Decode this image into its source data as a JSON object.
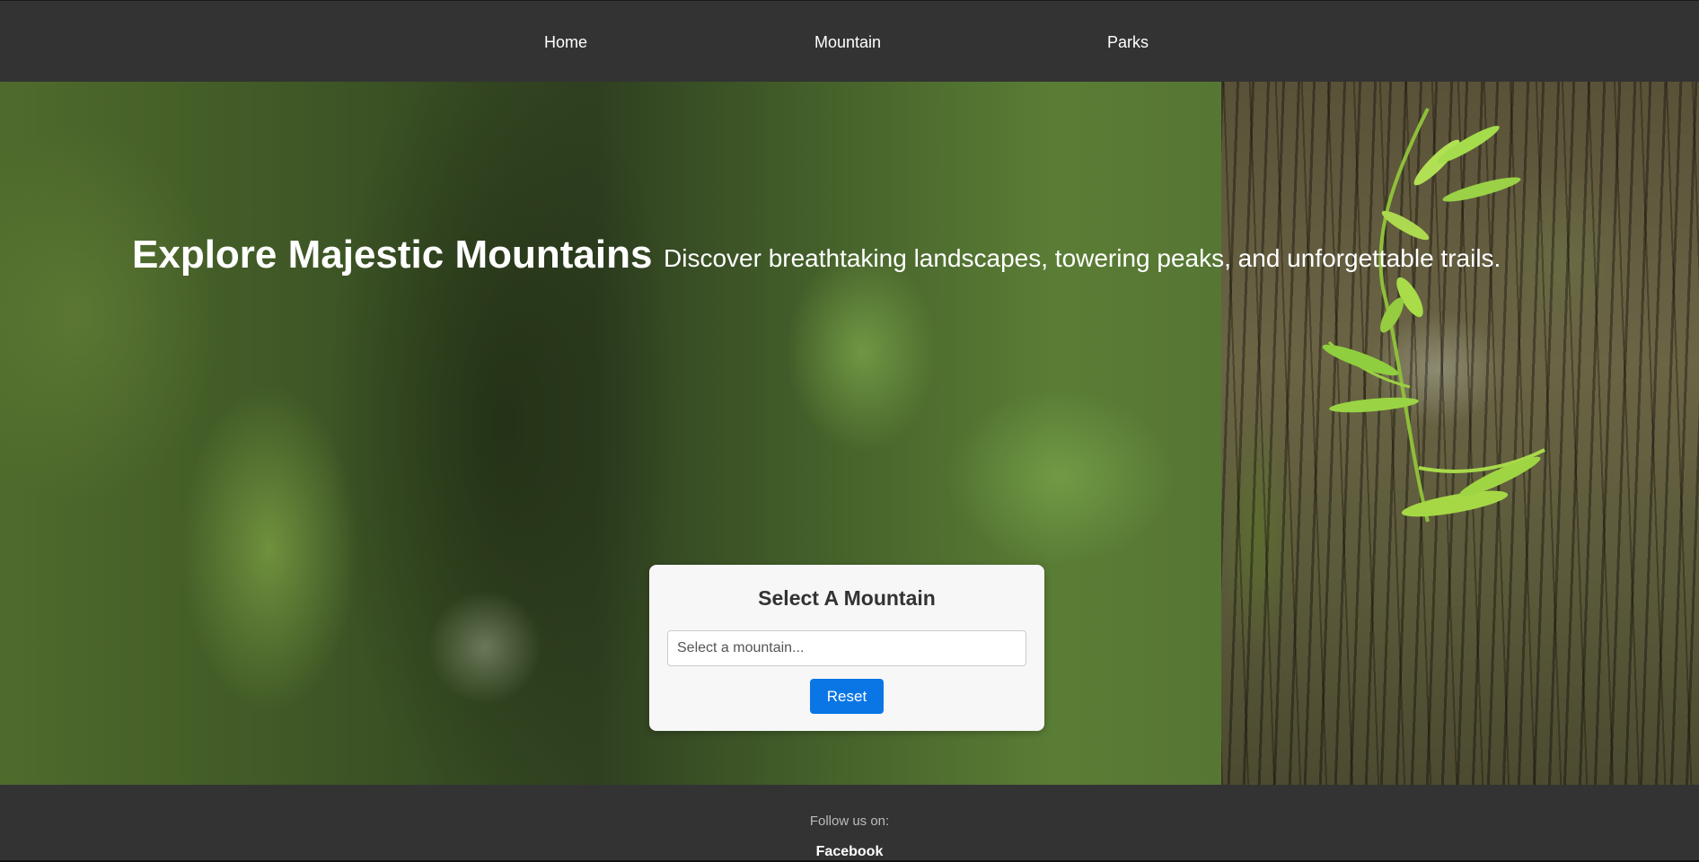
{
  "nav": {
    "items": [
      {
        "label": "Home"
      },
      {
        "label": "Mountain"
      },
      {
        "label": "Parks"
      }
    ]
  },
  "hero": {
    "title": "Explore Majestic Mountains",
    "subtitle": "Discover breathtaking landscapes, towering peaks, and unforgettable trails."
  },
  "selector": {
    "title": "Select A Mountain",
    "placeholder": "Select a mountain...",
    "reset_label": "Reset"
  },
  "footer": {
    "follow_text": "Follow us on:",
    "social_link": "Facebook"
  },
  "colors": {
    "header_bg": "#333333",
    "footer_bg": "#333333",
    "button_primary": "#0a76e6",
    "card_bg": "#f7f7f7"
  }
}
